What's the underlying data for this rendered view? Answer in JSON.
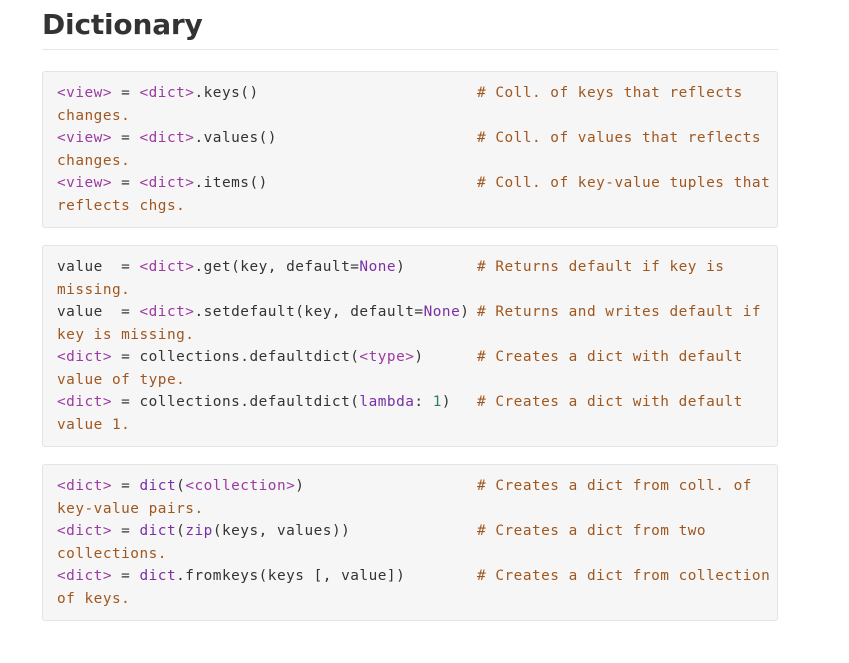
{
  "title": "Dictionary",
  "colors": {
    "comment": "#a0571f",
    "placeholder": "#9b3aa0",
    "keyword": "#7a2fa6",
    "number": "#2f7f5f",
    "text": "#333333",
    "block_bg": "#f6f6f6"
  },
  "blocks": [
    {
      "lines": [
        {
          "tokens": [
            {
              "t": "<view>",
              "k": "var"
            },
            {
              "t": " = ",
              "k": "op"
            },
            {
              "t": "<dict>",
              "k": "var"
            },
            {
              "t": ".keys()",
              "k": "name"
            }
          ],
          "comment": "# Coll. of keys that reflects",
          "wrap": "changes."
        },
        {
          "tokens": [
            {
              "t": "<view>",
              "k": "var"
            },
            {
              "t": " = ",
              "k": "op"
            },
            {
              "t": "<dict>",
              "k": "var"
            },
            {
              "t": ".values()",
              "k": "name"
            }
          ],
          "comment": "# Coll. of values that reflects",
          "wrap": "changes."
        },
        {
          "tokens": [
            {
              "t": "<view>",
              "k": "var"
            },
            {
              "t": " = ",
              "k": "op"
            },
            {
              "t": "<dict>",
              "k": "var"
            },
            {
              "t": ".items()",
              "k": "name"
            }
          ],
          "comment": "# Coll. of key-value tuples that",
          "wrap": "reflects chgs."
        }
      ]
    },
    {
      "lines": [
        {
          "tokens": [
            {
              "t": "value  = ",
              "k": "name"
            },
            {
              "t": "<dict>",
              "k": "var"
            },
            {
              "t": ".get(key, default=",
              "k": "name"
            },
            {
              "t": "None",
              "k": "kw"
            },
            {
              "t": ")",
              "k": "name"
            }
          ],
          "comment": "# Returns default if key is",
          "wrap": "missing."
        },
        {
          "tokens": [
            {
              "t": "value  = ",
              "k": "name"
            },
            {
              "t": "<dict>",
              "k": "var"
            },
            {
              "t": ".setdefault(key, default=",
              "k": "name"
            },
            {
              "t": "None",
              "k": "kw"
            },
            {
              "t": ")",
              "k": "name"
            }
          ],
          "comment": "# Returns and writes default if",
          "wrap": "key is missing."
        },
        {
          "tokens": [
            {
              "t": "<dict>",
              "k": "var"
            },
            {
              "t": " = collections.defaultdict(",
              "k": "name"
            },
            {
              "t": "<type>",
              "k": "var"
            },
            {
              "t": ")",
              "k": "name"
            }
          ],
          "comment": "# Creates a dict with default",
          "wrap": "value of type."
        },
        {
          "tokens": [
            {
              "t": "<dict>",
              "k": "var"
            },
            {
              "t": " = collections.defaultdict(",
              "k": "name"
            },
            {
              "t": "lambda",
              "k": "kw"
            },
            {
              "t": ": ",
              "k": "name"
            },
            {
              "t": "1",
              "k": "num"
            },
            {
              "t": ")",
              "k": "name"
            }
          ],
          "comment": "# Creates a dict with default",
          "wrap": "value 1."
        }
      ]
    },
    {
      "lines": [
        {
          "tokens": [
            {
              "t": "<dict>",
              "k": "var"
            },
            {
              "t": " = ",
              "k": "op"
            },
            {
              "t": "dict",
              "k": "kw"
            },
            {
              "t": "(",
              "k": "name"
            },
            {
              "t": "<collection>",
              "k": "var"
            },
            {
              "t": ")",
              "k": "name"
            }
          ],
          "comment": "# Creates a dict from coll. of",
          "wrap": "key-value pairs."
        },
        {
          "tokens": [
            {
              "t": "<dict>",
              "k": "var"
            },
            {
              "t": " = ",
              "k": "op"
            },
            {
              "t": "dict",
              "k": "kw"
            },
            {
              "t": "(",
              "k": "name"
            },
            {
              "t": "zip",
              "k": "kw"
            },
            {
              "t": "(keys, values))",
              "k": "name"
            }
          ],
          "comment": "# Creates a dict from two",
          "wrap": "collections."
        },
        {
          "tokens": [
            {
              "t": "<dict>",
              "k": "var"
            },
            {
              "t": " = ",
              "k": "op"
            },
            {
              "t": "dict",
              "k": "kw"
            },
            {
              "t": ".fromkeys(keys [, value])",
              "k": "name"
            }
          ],
          "comment": "# Creates a dict from collection",
          "wrap": "of keys."
        }
      ]
    }
  ]
}
